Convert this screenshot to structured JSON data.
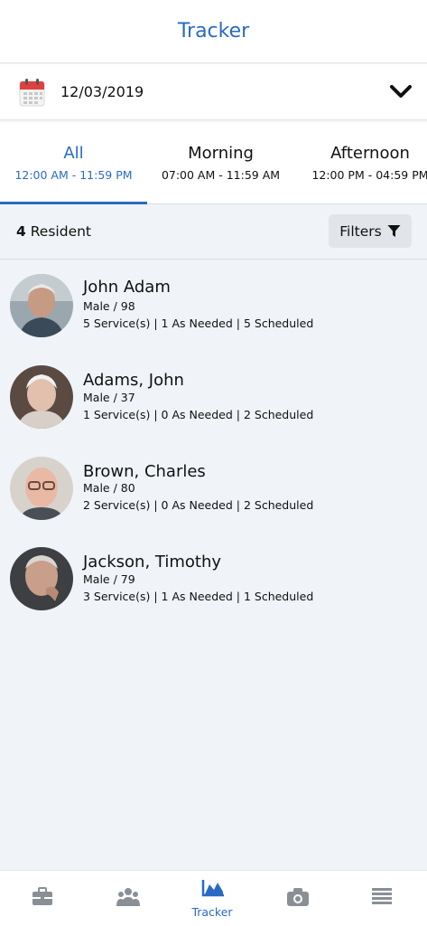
{
  "header": {
    "title": "Tracker"
  },
  "date_picker": {
    "value": "12/03/2019",
    "icon": "calendar-icon"
  },
  "tabs": [
    {
      "label": "All",
      "time": "12:00 AM - 11:59 PM",
      "active": true
    },
    {
      "label": "Morning",
      "time": "07:00 AM - 11:59 AM",
      "active": false
    },
    {
      "label": "Afternoon",
      "time": "12:00 PM - 04:59 PM",
      "active": false
    }
  ],
  "summary": {
    "count": "4",
    "label": "Resident",
    "filters_label": "Filters"
  },
  "residents": [
    {
      "name": "John Adam",
      "meta": "Male / 98",
      "services": "5 Service(s) | 1 As Needed | 5 Scheduled"
    },
    {
      "name": "Adams, John",
      "meta": "Male / 37",
      "services": "1 Service(s) | 0 As Needed | 2 Scheduled"
    },
    {
      "name": "Brown, Charles",
      "meta": "Male / 80",
      "services": "2 Service(s) | 0 As Needed | 2 Scheduled"
    },
    {
      "name": "Jackson, Timothy",
      "meta": "Male / 79",
      "services": "3 Service(s) | 1 As Needed | 1 Scheduled"
    }
  ],
  "bottom_nav": {
    "items": [
      {
        "icon": "briefcase-icon",
        "label": ""
      },
      {
        "icon": "group-icon",
        "label": ""
      },
      {
        "icon": "chart-icon",
        "label": "Tracker"
      },
      {
        "icon": "camera-icon",
        "label": ""
      },
      {
        "icon": "menu-icon",
        "label": ""
      }
    ]
  },
  "colors": {
    "accent": "#2a6ac4",
    "background": "#f0f3f7",
    "icon_gray": "#8a8f96"
  }
}
